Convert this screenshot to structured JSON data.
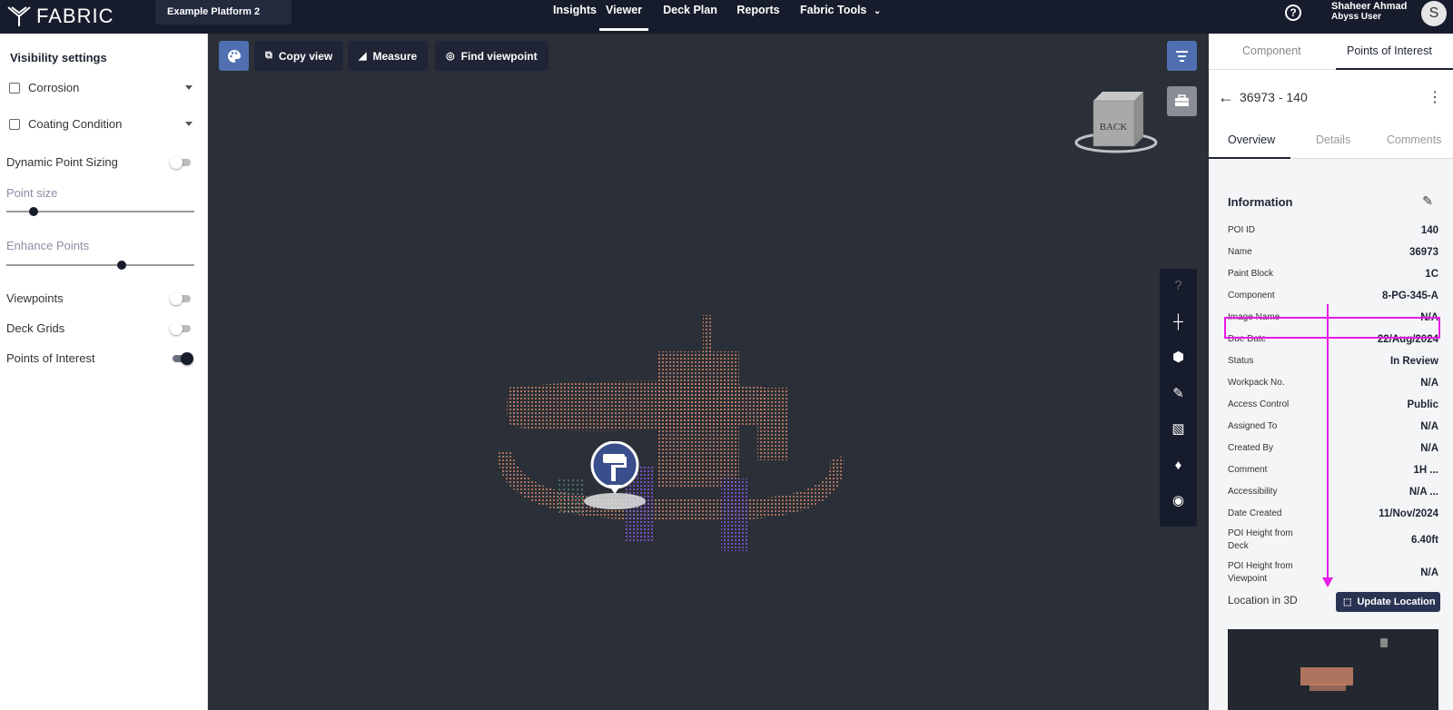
{
  "topbar": {
    "brand": "FABRIC",
    "platform": "Example Platform 2",
    "nav": [
      {
        "label": "Insights"
      },
      {
        "label": "Viewer"
      },
      {
        "label": "Deck Plan"
      },
      {
        "label": "Reports"
      },
      {
        "label": "Fabric Tools"
      }
    ],
    "user_name": "Shaheer Ahmad",
    "user_role": "Abyss User",
    "avatar_initial": "S"
  },
  "left_panel": {
    "title": "Visibility settings",
    "corrosion_label": "Corrosion",
    "coating_label": "Coating Condition",
    "dynamic_label": "Dynamic Point Sizing",
    "point_size_label": "Point size",
    "enhance_label": "Enhance Points",
    "viewpoints_label": "Viewpoints",
    "deckgrids_label": "Deck Grids",
    "poi_label": "Points of Interest"
  },
  "toolbar": {
    "copy_label": "Copy view",
    "measure_label": "Measure",
    "find_label": "Find viewpoint"
  },
  "viewcube": {
    "face": "BACK"
  },
  "right_panel": {
    "tab_component": "Component",
    "tab_poi": "Points of Interest",
    "title": "36973 - 140",
    "subtab_overview": "Overview",
    "subtab_details": "Details",
    "subtab_comments": "Comments",
    "info_title": "Information",
    "rows": [
      {
        "key": "POI ID",
        "value": "140"
      },
      {
        "key": "Name",
        "value": "36973"
      },
      {
        "key": "Paint Block",
        "value": "1C"
      },
      {
        "key": "Component",
        "value": "8-PG-345-A"
      },
      {
        "key": "Image Name",
        "value": "N/A"
      },
      {
        "key": "Due Date",
        "value": "22/Aug/2024"
      },
      {
        "key": "Status",
        "value": "In Review"
      },
      {
        "key": "Workpack No.",
        "value": "N/A"
      },
      {
        "key": "Access Control",
        "value": "Public"
      },
      {
        "key": "Assigned To",
        "value": "N/A"
      },
      {
        "key": "Created By",
        "value": "N/A"
      },
      {
        "key": "Comment",
        "value": "1H ..."
      },
      {
        "key": "Accessibility",
        "value": "N/A ..."
      },
      {
        "key": "Date Created",
        "value": "11/Nov/2024"
      },
      {
        "key": "POI Height from Deck",
        "value": "6.40ft"
      },
      {
        "key": "POI Height from Viewpoint",
        "value": "N/A"
      }
    ],
    "location_label": "Location in 3D",
    "update_label": "Update Location"
  }
}
